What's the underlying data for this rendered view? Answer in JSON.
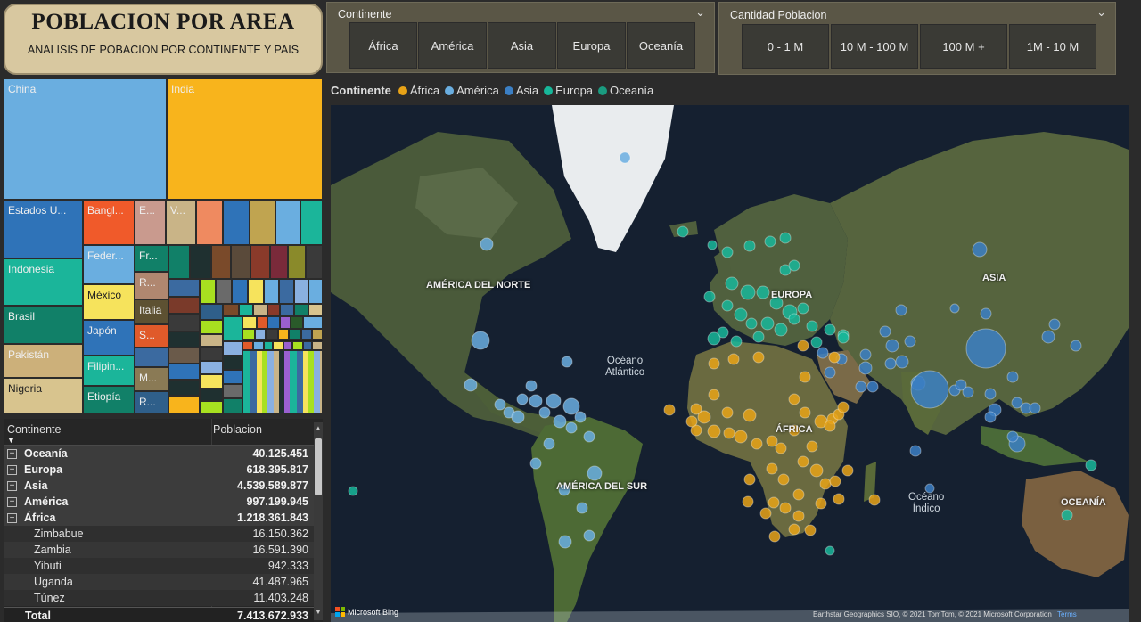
{
  "header": {
    "title": "POBLACION POR AREA",
    "subtitle": "ANALISIS DE POBACION POR CONTINENTE Y PAIS"
  },
  "slicer_continente": {
    "title": "Continente",
    "options": [
      "África",
      "América",
      "Asia",
      "Europa",
      "Oceanía"
    ]
  },
  "slicer_cantidad": {
    "title": "Cantidad Poblacion",
    "options": [
      "0 - 1 M",
      "10 M - 100 M",
      "100 M +",
      "1M - 10 M"
    ]
  },
  "treemap": {
    "labels": {
      "china": "China",
      "india": "India",
      "eeuu": "Estados U...",
      "bangl": "Bangl...",
      "e": "E...",
      "v": "V...",
      "indonesia": "Indonesia",
      "feder": "Feder...",
      "fr": "Fr...",
      "brasil": "Brasil",
      "mexico": "México",
      "r1": "R...",
      "italia": "Italia",
      "pakistan": "Pakistán",
      "japon": "Japón",
      "s": "S...",
      "filipin": "Filipin...",
      "m": "M...",
      "nigeria": "Nigeria",
      "etiopia": "Etiopía",
      "r2": "R..."
    }
  },
  "matrix": {
    "headers": {
      "continente": "Continente",
      "poblacion": "Poblacion"
    },
    "groups": [
      {
        "name": "Oceanía",
        "value": "40.125.451",
        "icon": "⊞"
      },
      {
        "name": "Europa",
        "value": "618.395.817",
        "icon": "⊞"
      },
      {
        "name": "Asia",
        "value": "4.539.589.877",
        "icon": "⊞"
      },
      {
        "name": "América",
        "value": "997.199.945",
        "icon": "⊞"
      },
      {
        "name": "África",
        "value": "1.218.361.843",
        "icon": "⊟"
      }
    ],
    "children": [
      {
        "name": "Zimbabue",
        "value": "16.150.362"
      },
      {
        "name": "Zambia",
        "value": "16.591.390"
      },
      {
        "name": "Yibuti",
        "value": "942.333"
      },
      {
        "name": "Uganda",
        "value": "41.487.965"
      },
      {
        "name": "Túnez",
        "value": "11.403.248"
      }
    ],
    "total": {
      "label": "Total",
      "value": "7.413.672.933"
    }
  },
  "map": {
    "legend_title": "Continente",
    "legend": [
      {
        "name": "África",
        "color": "#e8a317"
      },
      {
        "name": "América",
        "color": "#6aaee0"
      },
      {
        "name": "Asia",
        "color": "#3b7fc4"
      },
      {
        "name": "Europa",
        "color": "#17b79a"
      },
      {
        "name": "Oceanía",
        "color": "#1a9b80"
      }
    ],
    "labels": {
      "na": "AMÉRICA DEL NORTE",
      "europa": "EUROPA",
      "asia": "ASIA",
      "africa": "ÁFRICA",
      "sa": "AMÉRICA DEL SUR",
      "oceania": "OCEANÍA",
      "atl1": "Océano",
      "atl2": "Atlántico",
      "ind1": "Océano",
      "ind2": "Índico"
    },
    "bing": "Microsoft Bing",
    "attribution": "Earthstar Geographics SIO, © 2021 TomTom, © 2021 Microsoft Corporation",
    "terms": "Terms"
  }
}
